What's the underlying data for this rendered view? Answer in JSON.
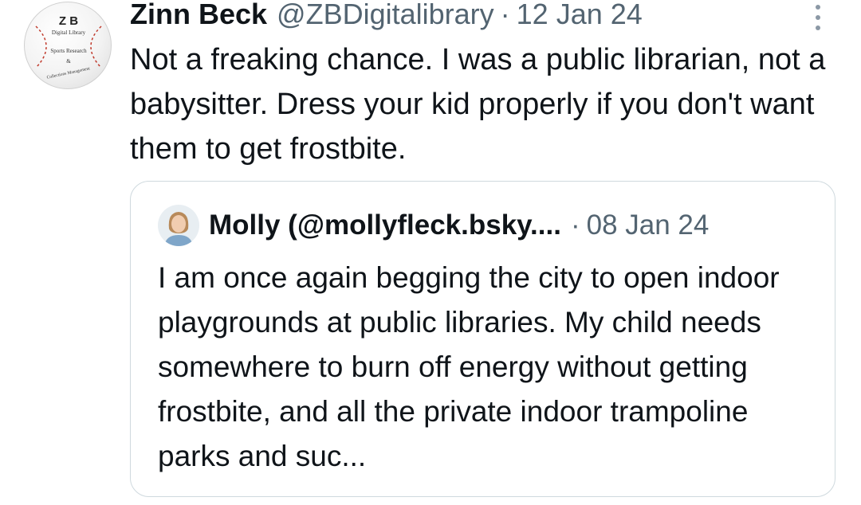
{
  "post": {
    "author": {
      "name": "Zinn Beck",
      "handle": "@ZBDigitalibrary",
      "avatar_logo": {
        "line1": "Z B",
        "line2": "Digital Library",
        "line3": "Sports Research",
        "line4": "&",
        "line5": "Collections Management"
      }
    },
    "separator": "·",
    "date": "12 Jan 24",
    "text": "Not a freaking chance. I was a public librarian, not a babysitter. Dress your kid properly if you don't want them to get frostbite.",
    "more_icon": "more-vertical-icon"
  },
  "quoted_post": {
    "author": {
      "name": "Molly (@mollyfleck.bsky....",
      "avatar_icon": "user-photo"
    },
    "separator": "·",
    "date": "08 Jan 24",
    "text": "I am once again begging the city to open indoor playgrounds at public libraries. My child needs somewhere to burn off energy without getting frostbite, and all the private indoor trampoline parks and suc..."
  },
  "colors": {
    "text_primary": "#0f1419",
    "text_secondary": "#536471",
    "border": "#cfd9de",
    "stitch_red": "#c0392b"
  }
}
